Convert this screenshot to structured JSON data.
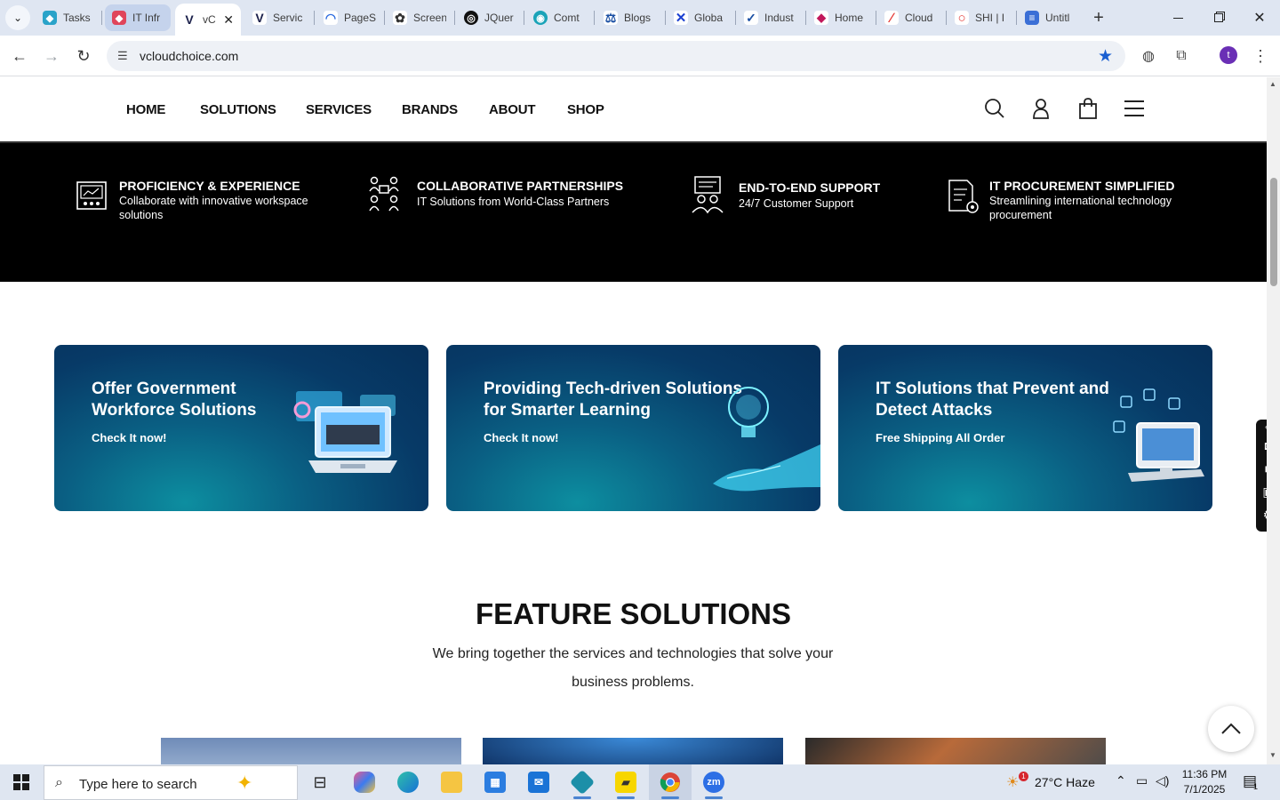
{
  "browser": {
    "tabs": [
      {
        "label": "Tasks",
        "favicon_color": "#2aa3c9",
        "favicon": "◆"
      },
      {
        "label": "IT Infr",
        "favicon_color": "#e0445a",
        "favicon": "◆"
      },
      {
        "label": "vC",
        "favicon_color": "#1a1f4a",
        "favicon": "V"
      },
      {
        "label": "Servic",
        "favicon_color": "#1a1f4a",
        "favicon": "V"
      },
      {
        "label": "PageS",
        "favicon_color": "#2d6cdf",
        "favicon": "◠"
      },
      {
        "label": "Screen",
        "favicon_color": "#333333",
        "favicon": "✿"
      },
      {
        "label": "JQuer",
        "favicon_color": "#111111",
        "favicon": "◎"
      },
      {
        "label": "Comt",
        "favicon_color": "#1aa3b8",
        "favicon": "◉"
      },
      {
        "label": "Blogs",
        "favicon_color": "#1a4fa3",
        "favicon": "⚖"
      },
      {
        "label": "Globa",
        "favicon_color": "#1a3fd1",
        "favicon": "✕"
      },
      {
        "label": "Indust",
        "favicon_color": "#1a4fa3",
        "favicon": "✓"
      },
      {
        "label": "Home",
        "favicon_color": "#c2185b",
        "favicon": "◆"
      },
      {
        "label": "Cloud",
        "favicon_color": "#e53935",
        "favicon": "∕"
      },
      {
        "label": "SHI | I",
        "favicon_color": "#e53935",
        "favicon": "○"
      },
      {
        "label": "Untitl",
        "favicon_color": "#3b6fd6",
        "favicon": "≡"
      }
    ],
    "url": "vcloudchoice.com",
    "profile_initial": "t"
  },
  "site": {
    "nav": [
      "HOME",
      "SOLUTIONS",
      "SERVICES",
      "BRANDS",
      "ABOUT",
      "SHOP"
    ],
    "features": [
      {
        "title": "PROFICIENCY & EXPERIENCE",
        "subtitle": "Collaborate with innovative workspace solutions",
        "icon": "presentation-icon"
      },
      {
        "title": "COLLABORATIVE PARTNERSHIPS",
        "subtitle": "IT Solutions from World-Class Partners",
        "icon": "team-icon"
      },
      {
        "title": "END-TO-END SUPPORT",
        "subtitle": "24/7 Customer Support",
        "icon": "support-icon"
      },
      {
        "title": "IT PROCUREMENT SIMPLIFIED",
        "subtitle": "Streamlining international technology procurement",
        "icon": "procurement-icon"
      }
    ],
    "banners": [
      {
        "title": "Offer Government Workforce Solutions",
        "cta": "Check It now!"
      },
      {
        "title": "Providing Tech-driven Solutions for Smarter Learning",
        "cta": "Check It now!"
      },
      {
        "title": "IT Solutions that Prevent and Detect Attacks",
        "cta": "Free Shipping All Order"
      }
    ],
    "section": {
      "title": "FEATURE SOLUTIONS",
      "description": "We bring together the services and technologies that solve your business problems."
    }
  },
  "taskbar": {
    "search_placeholder": "Type here to search",
    "weather": "27°C  Haze",
    "time": "11:36 PM",
    "date": "7/1/2025",
    "notification_count": "1",
    "weather_badge": "1"
  }
}
